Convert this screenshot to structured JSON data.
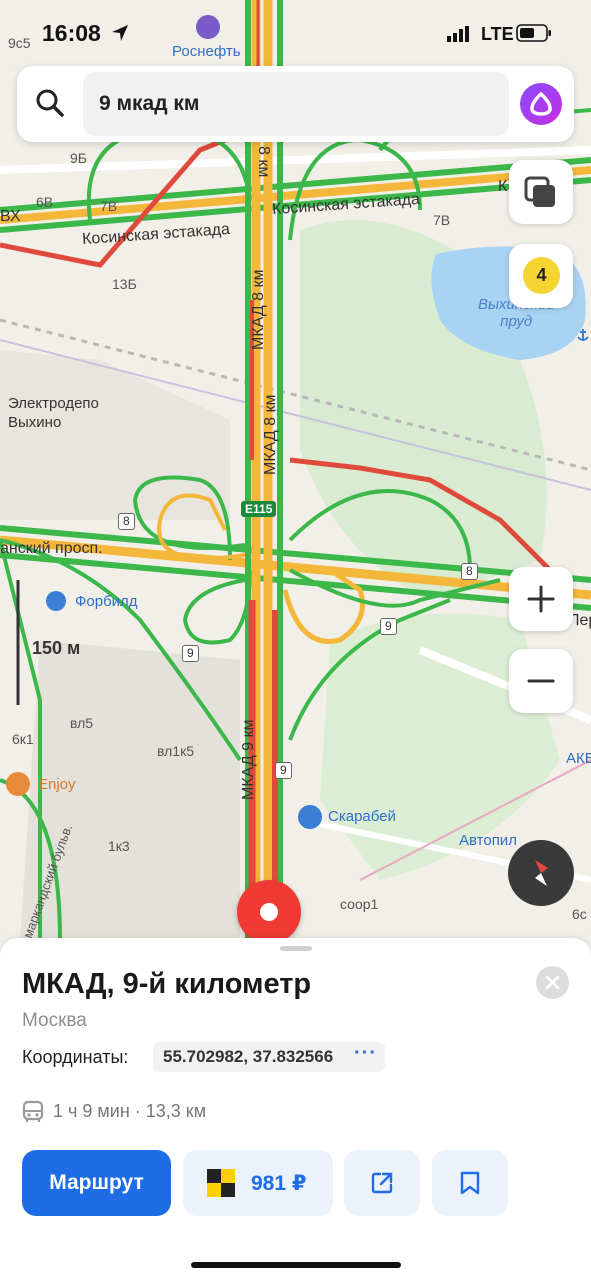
{
  "status_bar": {
    "time": "16:08",
    "network": "LTE"
  },
  "search": {
    "query": "9 мкад км"
  },
  "traffic": {
    "level": "4"
  },
  "scale": {
    "label": "150 м"
  },
  "map_labels": {
    "rosneft": "Роснефть",
    "kosinskaya_1": "Косинская эстакада",
    "kosinskaya_2": "Косинская эстакада",
    "mkad_8_a": "МКАД 8 км",
    "mkad_8_b": "МКАД 8 км",
    "mkad_8_top": "8 км",
    "mkad_9": "МКАД 9 км",
    "depot": "Электродепо\nВыхино",
    "pond": "Выхинский\nпруд",
    "prospect": "анский просп.",
    "forbild": "Форбилд",
    "enjoy": "Enjoy",
    "scarabey": "Скарабей",
    "autopilot": "Автопил",
    "akv": "АКВ",
    "boulevard": "маркандский бульв.",
    "bldg_9c5": "9с5",
    "bldg_9b": "9Б",
    "bldg_6v": "6В",
    "bldg_7v_a": "7В",
    "bldg_7v_b": "7В",
    "bldg_13b": "13Б",
    "bldg_vl5": "вл5",
    "bldg_vl1k5": "вл1к5",
    "bldg_6k1": "6к1",
    "bldg_1k3": "1к3",
    "bldg_soor1": "соор1",
    "bldg_6c": "6с",
    "bx": "ВХ",
    "per": "Пер",
    "ka_top": "К",
    "shield_8_a": "8",
    "shield_8_b": "8",
    "shield_9_a": "9",
    "shield_9_b": "9",
    "shield_9_c": "9",
    "shield_e115": "E115"
  },
  "place": {
    "title": "МКАД, 9-й километр",
    "city": "Москва",
    "coords_label": "Координаты:",
    "coords_value": "55.702982, 37.832566",
    "coords_more": "···",
    "transit_info": "1 ч 9 мин · 13,3 км"
  },
  "actions": {
    "route_label": "Маршрут",
    "taxi_price": "981 ₽"
  },
  "colors": {
    "accent": "#1f6de6",
    "traffic_red": "#e04a3c",
    "traffic_yellow": "#f4b73a",
    "traffic_green": "#3cb84a",
    "pin": "#ef3b34"
  }
}
